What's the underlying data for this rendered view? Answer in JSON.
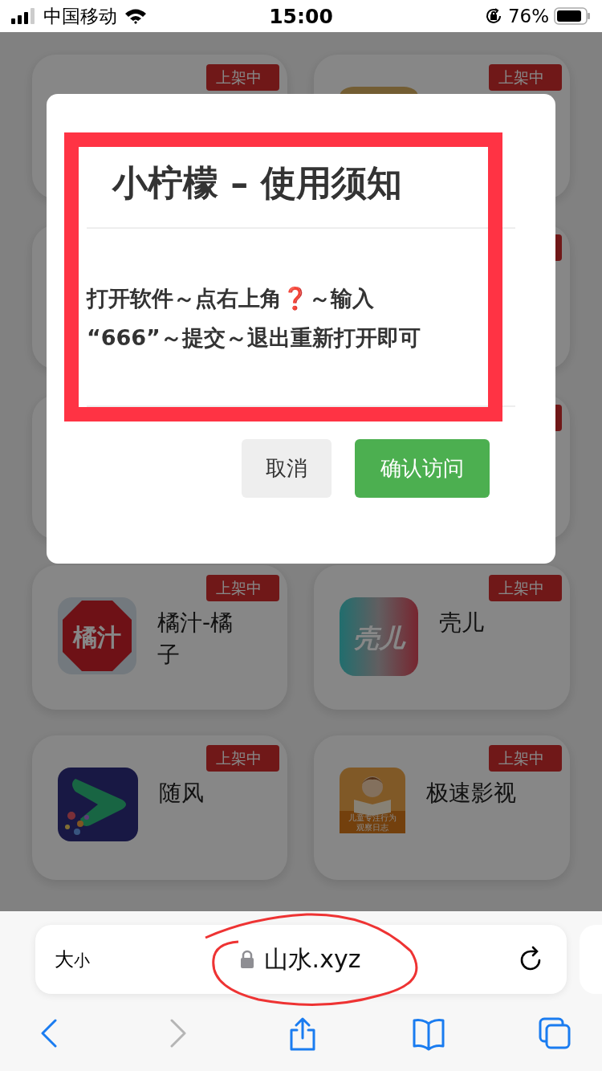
{
  "status_bar": {
    "carrier": "中国移动",
    "time": "15:00",
    "battery": "76%"
  },
  "cards": [
    {
      "kind": "covered",
      "badge": "上架中"
    },
    {
      "kind": "covered",
      "badge": "上架中"
    },
    {
      "kind": "covered"
    },
    {
      "kind": "covered-badge"
    },
    {
      "kind": "covered"
    },
    {
      "kind": "covered-badge"
    },
    {
      "kind": "octagon",
      "badge": "上架中",
      "name": "橘汁-橘子",
      "icon_text": "橘汁"
    },
    {
      "kind": "gradient",
      "badge": "上架中",
      "name": "壳儿",
      "icon_text": "壳儿"
    },
    {
      "kind": "play",
      "badge": "上架中",
      "name": "随风"
    },
    {
      "kind": "reader",
      "badge": "上架中",
      "name": "极速影视",
      "icon_text": "儿童专注行为观察日志"
    }
  ],
  "dialog": {
    "title": "小柠檬 – 使用须知",
    "body": [
      {
        "kind": "text",
        "text": "打开软件～点右上角"
      },
      {
        "kind": "mark",
        "text": "❓"
      },
      {
        "kind": "text",
        "text": "～输入"
      },
      {
        "kind": "text",
        "text": "“666”～提交～退出重新打开即可"
      }
    ],
    "buttons": [
      {
        "kind": "secondary",
        "label": "取消"
      },
      {
        "kind": "primary",
        "label": "确认访问"
      }
    ]
  },
  "browser": {
    "text_size": "大小",
    "url": "山水.xyz",
    "toolbar": [
      {
        "kind": "back",
        "disabled": false
      },
      {
        "kind": "forward",
        "disabled": true
      },
      {
        "kind": "share",
        "disabled": false
      },
      {
        "kind": "bookmarks",
        "disabled": false
      },
      {
        "kind": "tabs",
        "disabled": false
      }
    ]
  }
}
